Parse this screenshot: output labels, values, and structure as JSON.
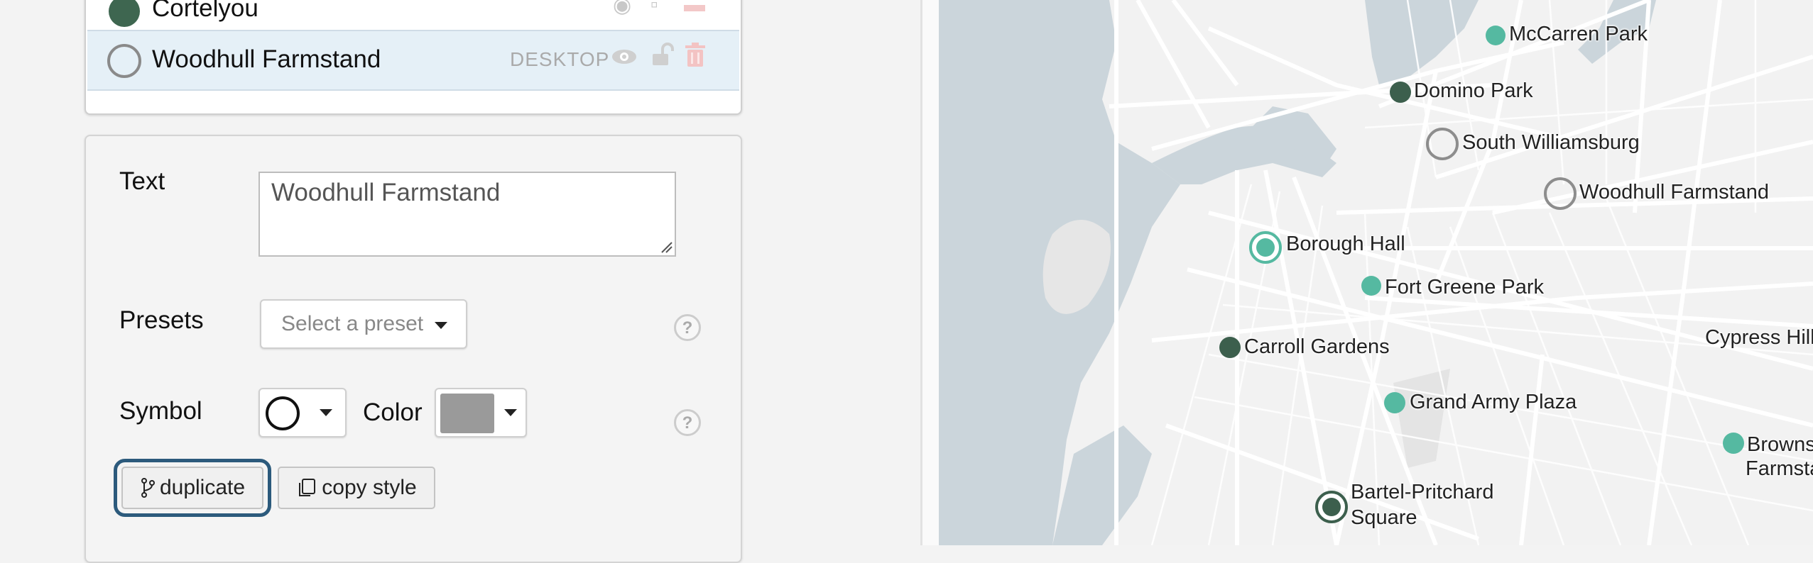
{
  "layer_list": {
    "items": [
      {
        "name": "Cortelyou",
        "symbol": "filled-circle"
      },
      {
        "name": "Woodhull Farmstand",
        "symbol": "hollow-circle",
        "device": "DESKTOP",
        "selected": true
      }
    ],
    "row_icons": [
      "eye-icon",
      "unlock-icon",
      "trash-icon"
    ]
  },
  "properties": {
    "text_label": "Text",
    "text_value": "Woodhull Farmstand",
    "presets_label": "Presets",
    "presets_placeholder": "Select a preset",
    "symbol_label": "Symbol",
    "color_label": "Color",
    "color_value": "#9a9a9a",
    "help_glyph": "?",
    "duplicate_label": "duplicate",
    "copy_style_label": "copy style"
  },
  "map": {
    "markers": [
      {
        "label": "McCarren Park",
        "style": "teal"
      },
      {
        "label": "Domino Park",
        "style": "dark"
      },
      {
        "label": "South Williamsburg",
        "style": "hollow-gray"
      },
      {
        "label": "Woodhull Farmstand",
        "style": "hollow-gray"
      },
      {
        "label": "Borough Hall",
        "style": "teal-ring"
      },
      {
        "label": "Fort Greene Park",
        "style": "teal"
      },
      {
        "label": "Carroll Gardens",
        "style": "dark"
      },
      {
        "label": "Grand Army Plaza",
        "style": "teal"
      },
      {
        "label": "Bartel-Pritchard",
        "label2": "Square",
        "style": "dark-ring"
      },
      {
        "label": "Brownsv",
        "label2": "Farmsta",
        "style": "teal"
      }
    ],
    "place_labels": [
      "Cypress Hill"
    ],
    "colors": {
      "water": "#cbd5db",
      "land": "#f2f2f2",
      "road": "#ffffff",
      "teal": "#55b9a1",
      "dark": "#3c5f4d"
    }
  }
}
